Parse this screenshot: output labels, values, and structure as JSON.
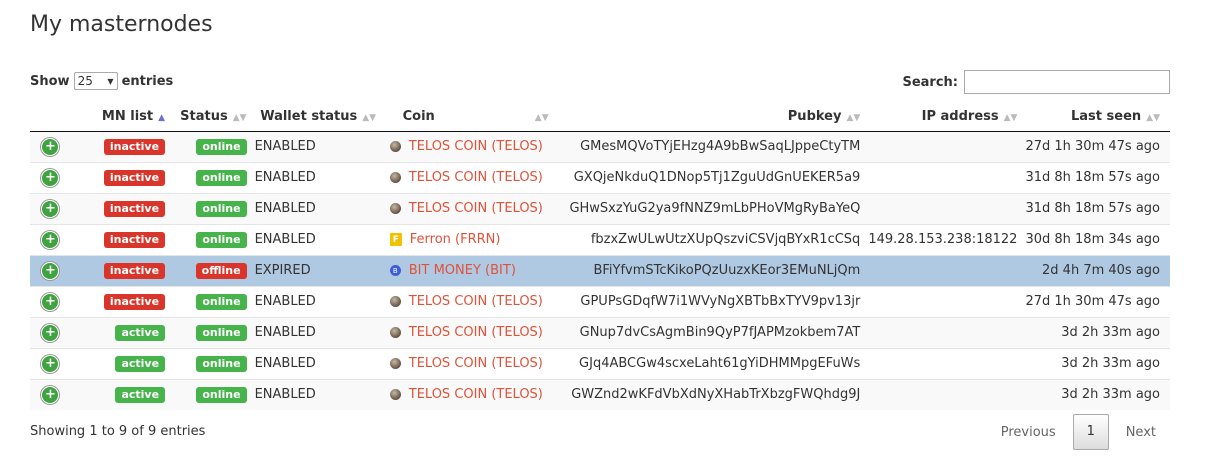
{
  "page_title": "My masternodes",
  "length": {
    "show_label": "Show",
    "value": "25",
    "entries_label": "entries"
  },
  "search": {
    "label": "Search:",
    "value": ""
  },
  "columns": [
    "MN list",
    "Status",
    "Wallet status",
    "Coin",
    "Pubkey",
    "IP address",
    "Last seen"
  ],
  "rows": [
    {
      "mn": "inactive",
      "status": "online",
      "wallet": "ENABLED",
      "coin": "TELOS COIN (TELOS)",
      "icon": "telos-icon",
      "pubkey": "GMesMQVoTYjEHzg4A9bBwSaqLJppeCtyTM",
      "ip": "",
      "seen": "27d 1h 30m 47s ago"
    },
    {
      "mn": "inactive",
      "status": "online",
      "wallet": "ENABLED",
      "coin": "TELOS COIN (TELOS)",
      "icon": "telos-icon",
      "pubkey": "GXQjeNkduQ1DNop5Tj1ZguUdGnUEKER5a9",
      "ip": "",
      "seen": "31d 8h 18m 57s ago"
    },
    {
      "mn": "inactive",
      "status": "online",
      "wallet": "ENABLED",
      "coin": "TELOS COIN (TELOS)",
      "icon": "telos-icon",
      "pubkey": "GHwSxzYuG2ya9fNNZ9mLbPHoVMgRyBaYeQ",
      "ip": "",
      "seen": "31d 8h 18m 57s ago"
    },
    {
      "mn": "inactive",
      "status": "online",
      "wallet": "ENABLED",
      "coin": "Ferron (FRRN)",
      "icon": "ferron-icon",
      "pubkey": "fbzxZwULwUtzXUpQszviCSVjqBYxR1cCSq",
      "ip": "149.28.153.238:18122",
      "seen": "30d 8h 18m 34s ago"
    },
    {
      "mn": "inactive",
      "status": "offline",
      "wallet": "EXPIRED",
      "coin": "BIT MONEY (BIT)",
      "icon": "bit-icon",
      "pubkey": "BFiYfvmSTcKikoPQzUuzxKEor3EMuNLjQm",
      "ip": "",
      "seen": "2d 4h 7m 40s ago",
      "selected": true
    },
    {
      "mn": "inactive",
      "status": "online",
      "wallet": "ENABLED",
      "coin": "TELOS COIN (TELOS)",
      "icon": "telos-icon",
      "pubkey": "GPUPsGDqfW7i1WVyNgXBTbBxTYV9pv13jr",
      "ip": "",
      "seen": "27d 1h 30m 47s ago"
    },
    {
      "mn": "active",
      "status": "online",
      "wallet": "ENABLED",
      "coin": "TELOS COIN (TELOS)",
      "icon": "telos-icon",
      "pubkey": "GNup7dvCsAgmBin9QyP7fJAPMzokbem7AT",
      "ip": "",
      "seen": "3d 2h 33m ago"
    },
    {
      "mn": "active",
      "status": "online",
      "wallet": "ENABLED",
      "coin": "TELOS COIN (TELOS)",
      "icon": "telos-icon",
      "pubkey": "GJq4ABCGw4scxeLaht61gYiDHMMpgEFuWs",
      "ip": "",
      "seen": "3d 2h 33m ago"
    },
    {
      "mn": "active",
      "status": "online",
      "wallet": "ENABLED",
      "coin": "TELOS COIN (TELOS)",
      "icon": "telos-icon",
      "pubkey": "GWZnd2wKFdVbXdNyXHabTrXbzgFWQhdg9J",
      "ip": "",
      "seen": "3d 2h 33m ago"
    }
  ],
  "info": "Showing 1 to 9 of 9 entries",
  "pager": {
    "previous": "Previous",
    "current": "1",
    "next": "Next"
  },
  "colors": {
    "inactive": "#d9352b",
    "offline": "#d9352b",
    "active": "#46b34b",
    "online": "#46b34b",
    "selected_row": "#b0c9e3",
    "coin_text": "#e0523a"
  }
}
